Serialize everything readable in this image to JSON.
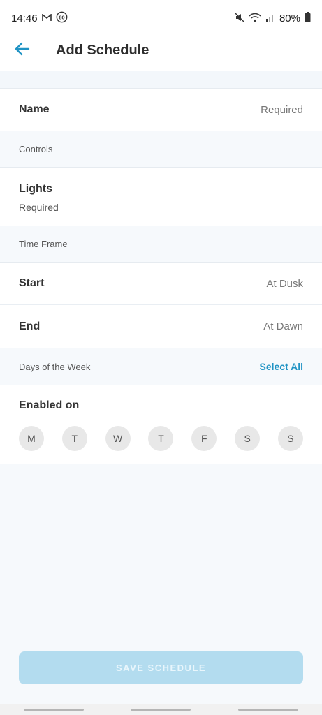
{
  "status_bar": {
    "time": "14:46",
    "left_icons": [
      "gmail-icon",
      "notification-badge-icon"
    ],
    "badge_text": "80",
    "battery": "80%",
    "right_icons": [
      "mute-icon",
      "wifi-icon",
      "signal-icon",
      "battery-icon"
    ]
  },
  "header": {
    "title": "Add Schedule"
  },
  "name_row": {
    "label": "Name",
    "placeholder": "Required"
  },
  "controls": {
    "section_label": "Controls",
    "lights_label": "Lights",
    "lights_value": "Required"
  },
  "time_frame": {
    "section_label": "Time Frame",
    "start_label": "Start",
    "start_value": "At Dusk",
    "end_label": "End",
    "end_value": "At Dawn"
  },
  "days": {
    "section_label": "Days of the Week",
    "select_all": "Select All",
    "enabled_label": "Enabled on",
    "items": [
      "M",
      "T",
      "W",
      "T",
      "F",
      "S",
      "S"
    ]
  },
  "footer": {
    "save_label": "SAVE SCHEDULE"
  },
  "colors": {
    "accent": "#1f93c4",
    "save_disabled": "#b3dcef",
    "background": "#f6f9fc"
  }
}
